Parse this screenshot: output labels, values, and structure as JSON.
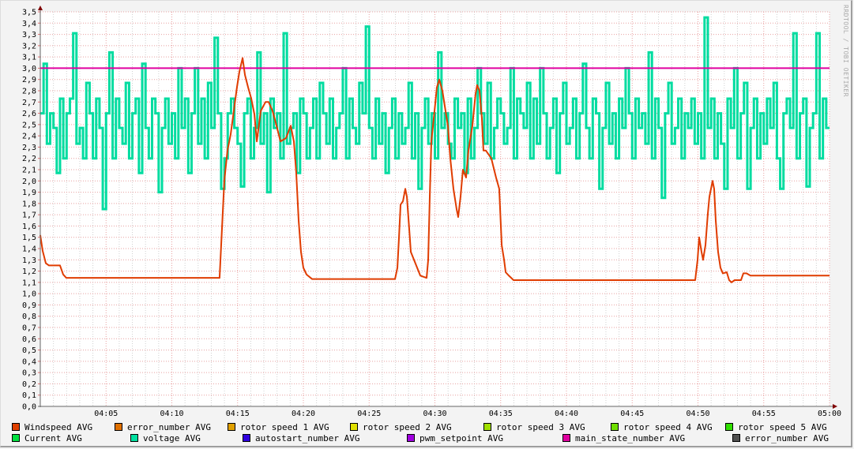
{
  "chart_data": {
    "type": "line",
    "title": "",
    "xlabel": "",
    "ylabel": "",
    "ylim": [
      0,
      3.5
    ],
    "xlim_minutes": [
      0,
      60
    ],
    "grid": true,
    "y_ticks": [
      "0,0",
      "0,1",
      "0,2",
      "0,3",
      "0,4",
      "0,5",
      "0,6",
      "0,7",
      "0,8",
      "0,9",
      "1,0",
      "1,1",
      "1,2",
      "1,3",
      "1,4",
      "1,5",
      "1,6",
      "1,7",
      "1,8",
      "1,9",
      "2,0",
      "2,1",
      "2,2",
      "2,3",
      "2,4",
      "2,5",
      "2,6",
      "2,7",
      "2,8",
      "2,9",
      "3,0",
      "3,1",
      "3,2",
      "3,3",
      "3,4",
      "3,5"
    ],
    "x_ticks": [
      "04:05",
      "04:10",
      "04:15",
      "04:20",
      "04:25",
      "04:30",
      "04:35",
      "04:40",
      "04:45",
      "04:50",
      "04:55",
      "05:00"
    ],
    "watermark": "RRDTOOL / TOBI OETIKER",
    "legend_placement": "bottom",
    "legend": [
      {
        "name": "Windspeed AVG",
        "color": "#e04000"
      },
      {
        "name": "error_number AVG",
        "color": "#e07000"
      },
      {
        "name": "rotor speed 1 AVG",
        "color": "#e0a000"
      },
      {
        "name": "rotor speed 2 AVG",
        "color": "#e0e000"
      },
      {
        "name": "rotor speed 3 AVG",
        "color": "#a0e000"
      },
      {
        "name": "rotor speed 4 AVG",
        "color": "#70e000"
      },
      {
        "name": "rotor speed 5 AVG",
        "color": "#30e000"
      },
      {
        "name": "Current AVG",
        "color": "#00e040"
      },
      {
        "name": "voltage AVG",
        "color": "#00e0a0"
      },
      {
        "name": "autostart_number AVG",
        "color": "#3000e0"
      },
      {
        "name": "pwm_setpoint AVG",
        "color": "#a000e0"
      },
      {
        "name": "main_state_number AVG",
        "color": "#e000a0"
      },
      {
        "name": "error_number AVG",
        "color": "#505050"
      }
    ],
    "series": [
      {
        "name": "voltage AVG",
        "color": "#00dca0",
        "step_minutes": 0.25,
        "values": [
          2.6,
          3.04,
          2.33,
          2.6,
          2.47,
          2.07,
          2.73,
          2.2,
          2.6,
          2.73,
          3.31,
          2.33,
          2.47,
          2.2,
          2.87,
          2.6,
          2.2,
          2.73,
          2.47,
          1.75,
          2.6,
          3.14,
          2.2,
          2.73,
          2.47,
          2.33,
          2.87,
          2.2,
          2.6,
          2.73,
          2.07,
          3.04,
          2.47,
          2.2,
          2.73,
          2.6,
          1.9,
          2.47,
          2.73,
          2.33,
          2.6,
          2.2,
          3.0,
          2.47,
          2.73,
          2.07,
          2.6,
          3.0,
          2.33,
          2.73,
          2.2,
          2.87,
          2.47,
          3.27,
          2.6,
          1.93,
          2.2,
          2.6,
          2.73,
          2.47,
          2.33,
          1.95,
          2.6,
          2.73,
          2.2,
          2.47,
          3.14,
          2.33,
          2.6,
          1.9,
          2.73,
          2.47,
          2.6,
          2.2,
          3.31,
          2.33,
          2.47,
          2.6,
          2.07,
          2.73,
          2.6,
          2.2,
          2.47,
          2.73,
          2.2,
          2.87,
          2.6,
          2.33,
          2.73,
          2.2,
          2.47,
          2.6,
          3.0,
          2.2,
          2.73,
          2.47,
          2.33,
          2.87,
          2.6,
          3.37,
          2.47,
          2.2,
          2.73,
          2.33,
          2.6,
          2.07,
          2.47,
          2.73,
          2.2,
          2.6,
          2.33,
          2.47,
          2.87,
          2.2,
          2.6,
          1.93,
          2.47,
          2.73,
          2.33,
          2.6,
          2.2,
          3.14,
          2.47,
          2.6,
          2.33,
          2.2,
          2.73,
          2.47,
          2.6,
          2.07,
          2.73,
          2.2,
          2.47,
          3.0,
          2.6,
          2.33,
          2.87,
          2.2,
          2.47,
          2.73,
          2.6,
          2.33,
          2.47,
          3.0,
          2.2,
          2.73,
          2.6,
          2.47,
          2.87,
          2.2,
          2.73,
          2.33,
          3.0,
          2.6,
          2.2,
          2.47,
          2.73,
          2.07,
          2.6,
          2.87,
          2.33,
          2.47,
          2.73,
          2.2,
          2.6,
          3.04,
          2.47,
          2.2,
          2.73,
          2.6,
          1.93,
          2.47,
          2.87,
          2.33,
          2.6,
          2.2,
          2.73,
          2.47,
          3.0,
          2.6,
          2.2,
          2.73,
          2.47,
          2.6,
          2.33,
          3.14,
          2.2,
          2.73,
          2.47,
          1.85,
          2.6,
          2.87,
          2.33,
          2.47,
          2.73,
          2.2,
          2.6,
          2.47,
          2.73,
          2.33,
          2.6,
          2.2,
          3.45,
          2.47,
          2.73,
          2.2,
          2.6,
          2.33,
          1.93,
          2.73,
          2.47,
          3.0,
          2.2,
          2.6,
          2.87,
          1.93,
          2.47,
          2.73,
          2.2,
          2.6,
          2.33,
          2.73,
          2.47,
          2.87,
          2.2,
          1.93,
          2.6,
          2.73,
          2.47,
          3.31,
          2.2,
          2.6,
          2.73,
          1.95,
          2.47,
          2.6,
          3.31,
          2.2,
          2.73,
          2.47
        ]
      },
      {
        "name": "main_state_number AVG",
        "color": "#e000a0",
        "points": [
          [
            0,
            3.0
          ],
          [
            60,
            3.0
          ]
        ]
      },
      {
        "name": "Windspeed AVG",
        "color": "#e03c00",
        "points": [
          [
            0,
            1.52
          ],
          [
            0.18,
            1.38
          ],
          [
            0.42,
            1.27
          ],
          [
            0.66,
            1.25
          ],
          [
            1.5,
            1.25
          ],
          [
            1.74,
            1.17
          ],
          [
            1.98,
            1.14
          ],
          [
            13.63,
            1.14
          ],
          [
            13.81,
            1.57
          ],
          [
            13.99,
            2.0
          ],
          [
            14.23,
            2.27
          ],
          [
            14.47,
            2.41
          ],
          [
            14.71,
            2.62
          ],
          [
            14.95,
            2.83
          ],
          [
            15.14,
            2.97
          ],
          [
            15.38,
            3.09
          ],
          [
            15.56,
            2.94
          ],
          [
            15.8,
            2.83
          ],
          [
            16.04,
            2.73
          ],
          [
            16.28,
            2.59
          ],
          [
            16.46,
            2.35
          ],
          [
            16.76,
            2.62
          ],
          [
            17.12,
            2.7
          ],
          [
            17.36,
            2.7
          ],
          [
            17.66,
            2.62
          ],
          [
            17.96,
            2.49
          ],
          [
            18.26,
            2.35
          ],
          [
            18.68,
            2.38
          ],
          [
            19.04,
            2.49
          ],
          [
            19.28,
            2.35
          ],
          [
            19.46,
            2.07
          ],
          [
            19.64,
            1.65
          ],
          [
            19.82,
            1.37
          ],
          [
            20.0,
            1.23
          ],
          [
            20.24,
            1.17
          ],
          [
            20.66,
            1.13
          ],
          [
            26.97,
            1.13
          ],
          [
            27.15,
            1.23
          ],
          [
            27.27,
            1.5
          ],
          [
            27.39,
            1.79
          ],
          [
            27.57,
            1.82
          ],
          [
            27.75,
            1.93
          ],
          [
            27.87,
            1.86
          ],
          [
            28.05,
            1.57
          ],
          [
            28.17,
            1.37
          ],
          [
            28.41,
            1.3
          ],
          [
            28.65,
            1.23
          ],
          [
            28.89,
            1.16
          ],
          [
            29.37,
            1.14
          ],
          [
            29.49,
            1.3
          ],
          [
            29.61,
            1.86
          ],
          [
            29.73,
            2.35
          ],
          [
            29.97,
            2.62
          ],
          [
            30.15,
            2.83
          ],
          [
            30.33,
            2.9
          ],
          [
            30.57,
            2.8
          ],
          [
            30.81,
            2.62
          ],
          [
            30.99,
            2.49
          ],
          [
            31.17,
            2.2
          ],
          [
            31.41,
            1.93
          ],
          [
            31.65,
            1.75
          ],
          [
            31.77,
            1.68
          ],
          [
            31.95,
            1.86
          ],
          [
            32.13,
            2.1
          ],
          [
            32.37,
            2.03
          ],
          [
            32.55,
            2.27
          ],
          [
            32.85,
            2.49
          ],
          [
            33.09,
            2.77
          ],
          [
            33.21,
            2.85
          ],
          [
            33.39,
            2.8
          ],
          [
            33.57,
            2.56
          ],
          [
            33.69,
            2.27
          ],
          [
            33.87,
            2.27
          ],
          [
            34.29,
            2.2
          ],
          [
            34.65,
            2.03
          ],
          [
            34.89,
            1.93
          ],
          [
            35.08,
            1.43
          ],
          [
            35.26,
            1.3
          ],
          [
            35.38,
            1.19
          ],
          [
            35.62,
            1.16
          ],
          [
            35.98,
            1.12
          ],
          [
            49.79,
            1.12
          ],
          [
            49.97,
            1.3
          ],
          [
            50.09,
            1.5
          ],
          [
            50.27,
            1.37
          ],
          [
            50.39,
            1.3
          ],
          [
            50.57,
            1.43
          ],
          [
            50.75,
            1.71
          ],
          [
            50.87,
            1.86
          ],
          [
            50.99,
            1.93
          ],
          [
            51.11,
            2.0
          ],
          [
            51.23,
            1.93
          ],
          [
            51.35,
            1.65
          ],
          [
            51.53,
            1.37
          ],
          [
            51.71,
            1.23
          ],
          [
            51.89,
            1.18
          ],
          [
            52.19,
            1.19
          ],
          [
            52.37,
            1.12
          ],
          [
            52.55,
            1.1
          ],
          [
            52.79,
            1.12
          ],
          [
            53.27,
            1.12
          ],
          [
            53.45,
            1.18
          ],
          [
            53.69,
            1.18
          ],
          [
            53.99,
            1.16
          ],
          [
            60,
            1.16
          ]
        ]
      }
    ]
  }
}
